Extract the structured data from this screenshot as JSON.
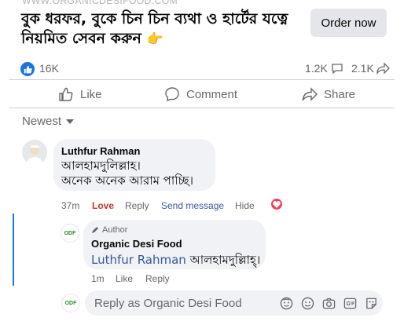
{
  "ad": {
    "url_text": "WWW.ORGANICDESIFOOD.COM",
    "headline": "বুক ধরফর, বুকে চিন চিন ব্যথা ও হার্টের যত্নে নিয়মিত সেবন করুন",
    "headline_emoji": "👉",
    "order_button": "Order now"
  },
  "stats": {
    "likes": "16K",
    "comments": "1.2K",
    "shares": "2.1K"
  },
  "actions": {
    "like": "Like",
    "comment": "Comment",
    "share": "Share"
  },
  "sort": {
    "label": "Newest"
  },
  "comment": {
    "author": "Luthfur Rahman",
    "line1": "আলহামদুলিল্লাহ।",
    "line2": "অনেক অনেক আরাম পাচ্ছি।",
    "time": "37m",
    "love": "Love",
    "reply": "Reply",
    "send_message": "Send message",
    "hide": "Hide"
  },
  "reply": {
    "badge": "Author",
    "author": "Organic Desi Food",
    "mention": "Luthfur Rahman",
    "text": "আলহামদুল্লিাহ্।",
    "time": "1m",
    "like": "Like",
    "reply": "Reply",
    "avatar_text": "ODF"
  },
  "composer": {
    "placeholder": "Reply as Organic Desi Food",
    "icons": [
      "sticker-icon",
      "emoji-icon",
      "camera-icon",
      "gif-icon",
      "sticker-alt-icon"
    ]
  },
  "colors": {
    "accent": "#1877f2",
    "love": "#c0392b",
    "link": "#385898"
  }
}
